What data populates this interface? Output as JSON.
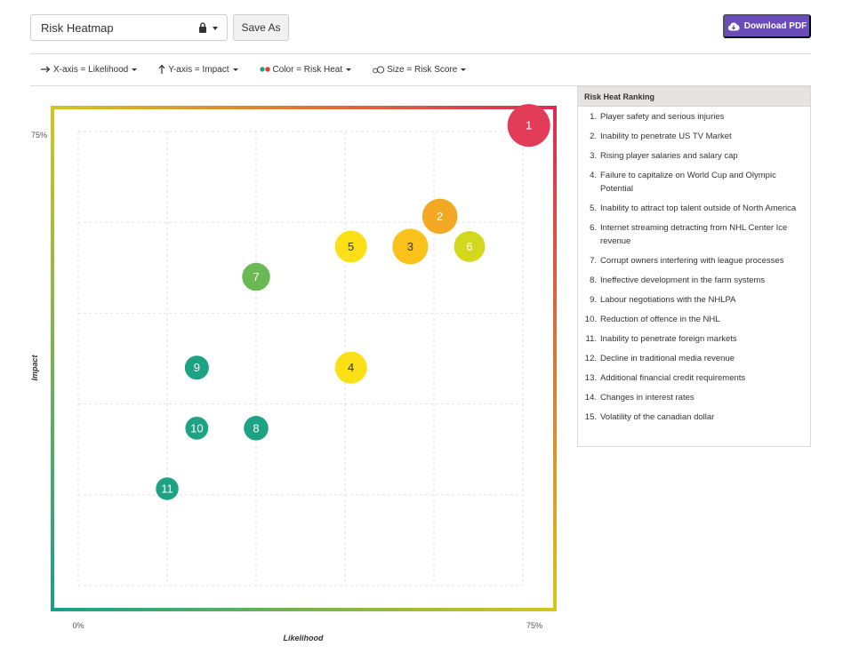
{
  "toolbar": {
    "view_name": "Risk Heatmap",
    "save_as_label": "Save As",
    "download_label": "Download PDF",
    "lock_icon": "lock-icon",
    "cloud_icon": "cloud-download-icon"
  },
  "controls": {
    "x_axis": "X-axis = Likelihood",
    "y_axis": "Y-axis = Impact",
    "color": "Color = Risk Heat",
    "size": "Size = Risk Score"
  },
  "ranking": {
    "title": "Risk Heat Ranking",
    "items": [
      {
        "num": "1.",
        "label": "Player safety and serious injuries"
      },
      {
        "num": "2.",
        "label": "Inability to penetrate US TV Market"
      },
      {
        "num": "3.",
        "label": "Rising player salaries and salary cap"
      },
      {
        "num": "4.",
        "label": "Failure to capitalize on World Cup and Olympic Potential"
      },
      {
        "num": "5.",
        "label": "Inability to attract top talent outside of North America"
      },
      {
        "num": "6.",
        "label": "Internet streaming detracting from NHL Center Ice revenue"
      },
      {
        "num": "7.",
        "label": "Corrupt owners interfering with league processes"
      },
      {
        "num": "8.",
        "label": "Ineffective development in the farm systems"
      },
      {
        "num": "9.",
        "label": "Labour negotiations with the NHLPA"
      },
      {
        "num": "10.",
        "label": "Reduction of offence in the NHL"
      },
      {
        "num": "11.",
        "label": "Inability to penetrate foreign markets"
      },
      {
        "num": "12.",
        "label": "Decline in traditional media revenue"
      },
      {
        "num": "13.",
        "label": "Additional financial credit requirements"
      },
      {
        "num": "14.",
        "label": "Changes in interest rates"
      },
      {
        "num": "15.",
        "label": "Volatility of the canadian dollar"
      }
    ]
  },
  "chart_data": {
    "type": "scatter",
    "xlabel": "Likelihood",
    "ylabel": "Impact",
    "xlim": [
      0,
      75
    ],
    "ylim": [
      0,
      75
    ],
    "x_tick_labels": [
      "0%",
      "75%"
    ],
    "y_tick_labels": [
      "75%"
    ],
    "grid": true,
    "gradient_colors": {
      "low": "#16a08a",
      "mid": "#d7c51a",
      "high": "#dd2a55"
    },
    "points": [
      {
        "label": "1",
        "x": 76,
        "y": 76,
        "score": 1.0,
        "color": "#e33c58"
      },
      {
        "label": "2",
        "x": 61,
        "y": 61,
        "score": 0.72,
        "color": "#f3a823"
      },
      {
        "label": "3",
        "x": 56,
        "y": 56,
        "score": 0.74,
        "color": "#fbc21c"
      },
      {
        "label": "4",
        "x": 46,
        "y": 36,
        "score": 0.6,
        "color": "#fbdf17"
      },
      {
        "label": "5",
        "x": 46,
        "y": 56,
        "score": 0.6,
        "color": "#fbdf17"
      },
      {
        "label": "6",
        "x": 66,
        "y": 56,
        "score": 0.56,
        "color": "#d3d81c"
      },
      {
        "label": "7",
        "x": 30,
        "y": 51,
        "score": 0.45,
        "color": "#6bb955"
      },
      {
        "label": "8",
        "x": 30,
        "y": 26,
        "score": 0.32,
        "color": "#1da284"
      },
      {
        "label": "9",
        "x": 20,
        "y": 36,
        "score": 0.3,
        "color": "#1da284"
      },
      {
        "label": "10",
        "x": 20,
        "y": 26,
        "score": 0.26,
        "color": "#1da284"
      },
      {
        "label": "11",
        "x": 15,
        "y": 16,
        "score": 0.25,
        "color": "#1da284"
      }
    ]
  }
}
